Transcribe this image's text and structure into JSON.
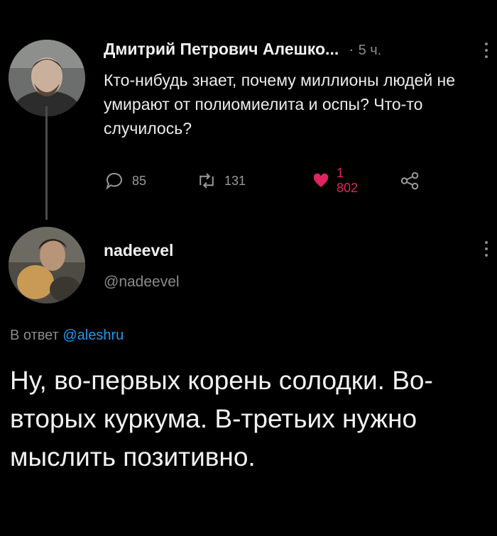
{
  "tweet1": {
    "author": "Дмитрий Петрович Алешко...",
    "separator": "·",
    "time": "5 ч.",
    "text": "Кто-нибудь знает, почему миллионы людей не умирают от полиомиелита и оспы? Что-то случилось?",
    "replies": "85",
    "retweets": "131",
    "likes": "1 802"
  },
  "tweet2": {
    "name": "nadeevel",
    "handle": "@nadeevel",
    "reply_prefix": "В ответ",
    "reply_mention": "@aleshru",
    "text": "Ну, во-первых корень солодки. Во-вторых куркума. В-третьих нужно мыслить позитивно."
  },
  "icons": [
    "reply-icon",
    "retweet-icon",
    "like-icon",
    "share-icon",
    "more-options-icon"
  ],
  "colors": {
    "background": "#000000",
    "like": "#e0245e",
    "mention": "#1d9bf0",
    "muted": "#8b8b8b"
  }
}
